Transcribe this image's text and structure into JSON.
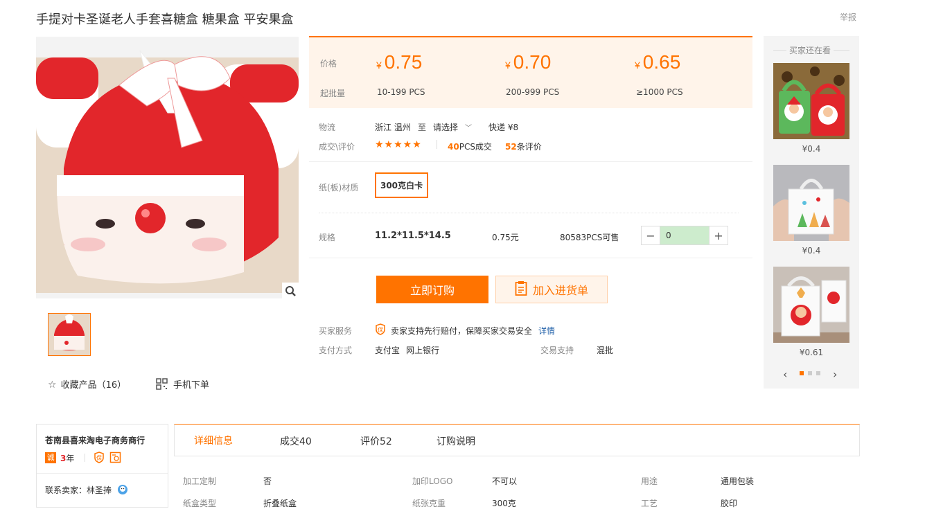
{
  "product": {
    "title": "手提对卡圣诞老人手套喜糖盒 糖果盒 平安果盒",
    "report": "举报"
  },
  "gallery": {
    "favorite_label": "收藏产品（16）",
    "mobile_label": "手机下单"
  },
  "pricing": {
    "price_label": "价格",
    "min_label": "起批量",
    "currency": "¥",
    "tiers": [
      {
        "price": "0.75",
        "qty": "10-199  PCS"
      },
      {
        "price": "0.70",
        "qty": "200-999  PCS"
      },
      {
        "price": "0.65",
        "qty": "≥1000  PCS"
      }
    ]
  },
  "logistics": {
    "label": "物流",
    "from": "浙江 温州",
    "to_word": "至",
    "select": "请选择",
    "express": "快递 ¥8"
  },
  "deals": {
    "label": "成交\\评价",
    "stars": "★★★★★",
    "rating": 5,
    "deals_count": "40",
    "deals_unit": "PCS成交",
    "reviews_count": "52",
    "reviews_unit": "条评价"
  },
  "material": {
    "label": "纸(板)材质",
    "option": "300克白卡"
  },
  "spec": {
    "label": "规格",
    "size": "11.2*11.5*14.5",
    "price": "0.75元",
    "stock": "80583PCS可售",
    "minus": "−",
    "quantity": "0",
    "plus": "+"
  },
  "actions": {
    "buy": "立即订购",
    "cart": "加入进货单"
  },
  "service": {
    "label": "买家服务",
    "text": "卖家支持先行赔付，保障买家交易安全",
    "link": "详情",
    "pay_label": "支付方式",
    "pay1": "支付宝",
    "pay2": "网上银行",
    "trade_label": "交易支持",
    "trade_value": "混批"
  },
  "sidebar": {
    "title": "买家还在看",
    "items": [
      {
        "price": "¥0.4"
      },
      {
        "price": "¥0.4"
      },
      {
        "price": "¥0.61"
      }
    ]
  },
  "shop": {
    "name": "苍南县喜来淘电子商务商行",
    "years": "3",
    "years_unit": "年",
    "contact": "联系卖家：林圣捧"
  },
  "tabs": [
    {
      "label": "详细信息"
    },
    {
      "label": "成交40"
    },
    {
      "label": "评价52"
    },
    {
      "label": "订购说明"
    }
  ],
  "details": [
    {
      "label": "加工定制",
      "value": "否"
    },
    {
      "label": "加印LOGO",
      "value": "不可以"
    },
    {
      "label": "用途",
      "value": "通用包装"
    },
    {
      "label": "纸盒类型",
      "value": "折叠纸盒"
    },
    {
      "label": "纸张克重",
      "value": "300克"
    },
    {
      "label": "工艺",
      "value": "胶印"
    }
  ],
  "colors": {
    "accent": "#ff7300",
    "price_bg": "#fff4ea",
    "santa_red": "#e2262b"
  }
}
